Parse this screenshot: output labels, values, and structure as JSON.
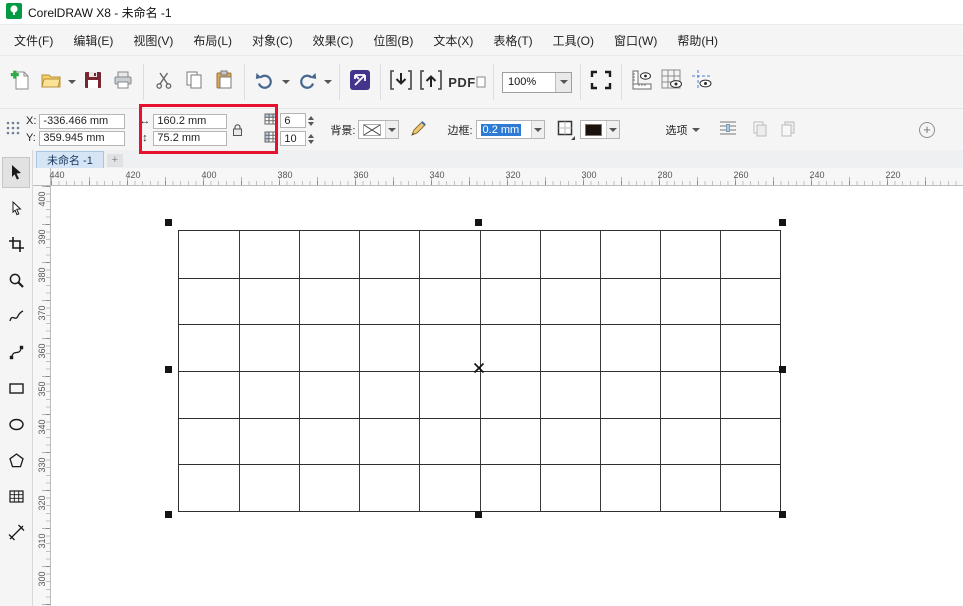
{
  "window": {
    "title": "CorelDRAW X8 - 未命名 -1"
  },
  "menu": {
    "items": [
      {
        "key": "file",
        "label": "文件(F)"
      },
      {
        "key": "edit",
        "label": "编辑(E)"
      },
      {
        "key": "view",
        "label": "视图(V)"
      },
      {
        "key": "layout",
        "label": "布局(L)"
      },
      {
        "key": "object",
        "label": "对象(C)"
      },
      {
        "key": "effects",
        "label": "效果(C)"
      },
      {
        "key": "bitmaps",
        "label": "位图(B)"
      },
      {
        "key": "text",
        "label": "文本(X)"
      },
      {
        "key": "table",
        "label": "表格(T)"
      },
      {
        "key": "tools",
        "label": "工具(O)"
      },
      {
        "key": "window",
        "label": "窗口(W)"
      },
      {
        "key": "help",
        "label": "帮助(H)"
      }
    ]
  },
  "standard_toolbar": {
    "zoom_value": "100%",
    "pdf_label": "PDF"
  },
  "property_bar": {
    "x_label": "X:",
    "x_value": "-336.466 mm",
    "y_label": "Y:",
    "y_value": "359.945 mm",
    "width_value": "160.2 mm",
    "height_value": "75.2 mm",
    "rows_value": "6",
    "cols_value": "10",
    "background_label": "背景:",
    "border_label": "边框:",
    "border_width_value": "0.2 mm",
    "options_label": "选项"
  },
  "tabs": {
    "active_label": "未命名 -1",
    "add_label": "+"
  },
  "rulers": {
    "horizontal": [
      "440",
      "420",
      "400",
      "380",
      "360",
      "340",
      "320",
      "300",
      "280",
      "260",
      "240",
      "220"
    ],
    "vertical": [
      "400",
      "390",
      "380",
      "370",
      "360",
      "350",
      "340",
      "330",
      "320",
      "310",
      "300"
    ]
  },
  "toolbox": {
    "tools": [
      {
        "name": "pick-tool",
        "selected": true
      },
      {
        "name": "shape-tool"
      },
      {
        "name": "crop-tool"
      },
      {
        "name": "zoom-tool"
      },
      {
        "name": "freehand-tool"
      },
      {
        "name": "bezier-tool"
      },
      {
        "name": "rectangle-tool"
      },
      {
        "name": "ellipse-tool"
      },
      {
        "name": "polygon-tool"
      },
      {
        "name": "table-tool"
      },
      {
        "name": "line-tool"
      }
    ]
  },
  "canvas": {
    "table": {
      "rows": 6,
      "cols": 10
    }
  },
  "annotation": {
    "highlight_color": "#e8112d",
    "selection_color": "#2e7bd6"
  }
}
